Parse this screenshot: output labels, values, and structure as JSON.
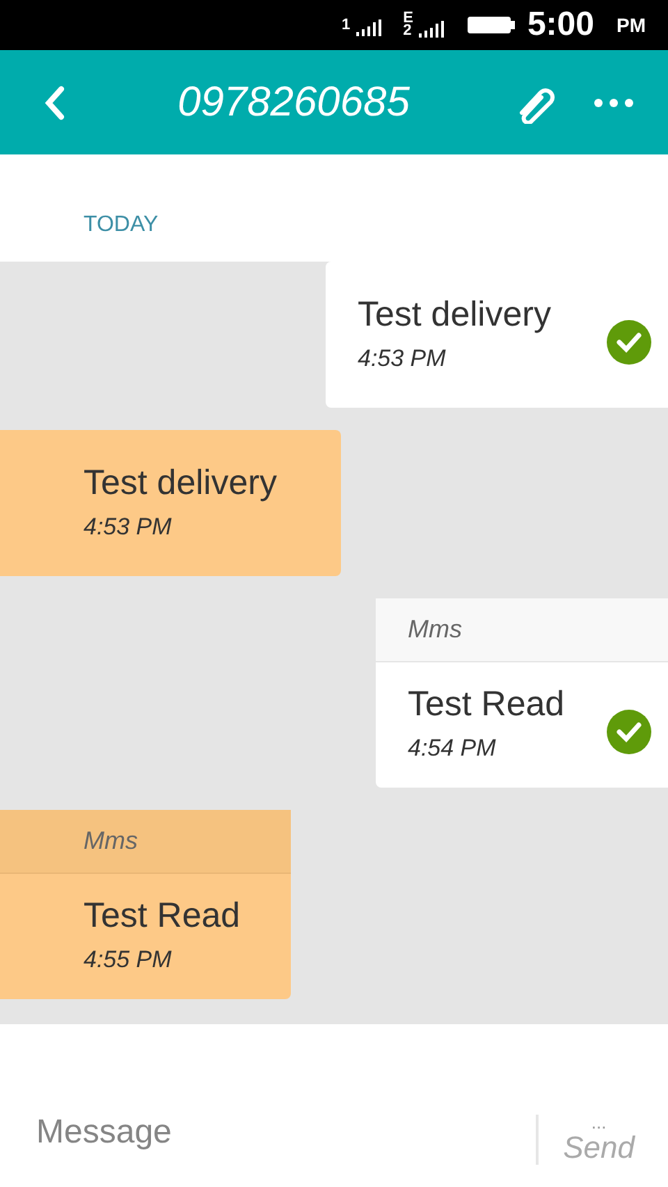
{
  "status_bar": {
    "sim_1": "1",
    "sim_2_network": "E",
    "sim_2": "2",
    "time": "5:00",
    "meridiem": "PM"
  },
  "header": {
    "title": "0978260685"
  },
  "date_divider": "TODAY",
  "messages": [
    {
      "kind": "outgoing",
      "text": "Test delivery",
      "time": "4:53 PM",
      "delivered": true
    },
    {
      "kind": "incoming",
      "text": "Test delivery",
      "time": "4:53 PM",
      "delivered": false
    },
    {
      "kind": "outgoing",
      "type_label": "Mms",
      "text": "Test Read",
      "time": "4:54 PM",
      "delivered": true
    },
    {
      "kind": "incoming",
      "type_label": "Mms",
      "text": "Test Read",
      "time": "4:55 PM",
      "delivered": false
    }
  ],
  "composer": {
    "placeholder": "Message",
    "counter": "...",
    "send": "Send"
  }
}
